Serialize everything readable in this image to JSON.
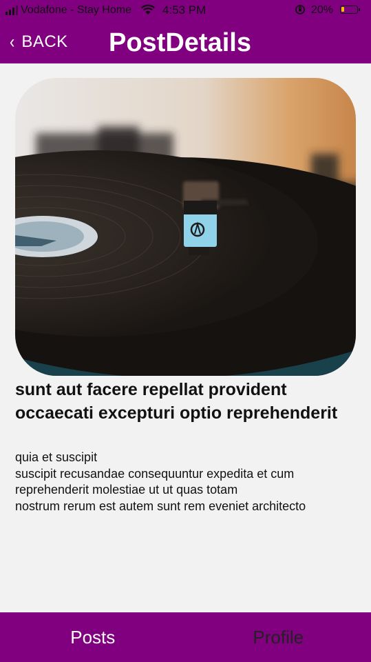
{
  "status_bar": {
    "carrier": "Vodafone - Stay Home",
    "time": "4:53 PM",
    "battery": "20%",
    "battery_level": 0.2
  },
  "header": {
    "back_label": "BACK",
    "title": "PostDetails"
  },
  "post": {
    "image_icon": "turntable-photo",
    "title": "sunt aut facere repellat provident occaecati excepturi optio reprehenderit",
    "body": "quia et suscipit\nsuscipit recusandae consequuntur expedita et cum\nreprehenderit molestiae ut ut quas totam\nnostrum rerum est autem sunt rem eveniet architecto"
  },
  "tabs": [
    {
      "label": "Posts",
      "active": true
    },
    {
      "label": "Profile",
      "active": false
    }
  ],
  "colors": {
    "accent": "#800080",
    "background": "#f2f2f2",
    "battery_fill": "#f5c400"
  }
}
